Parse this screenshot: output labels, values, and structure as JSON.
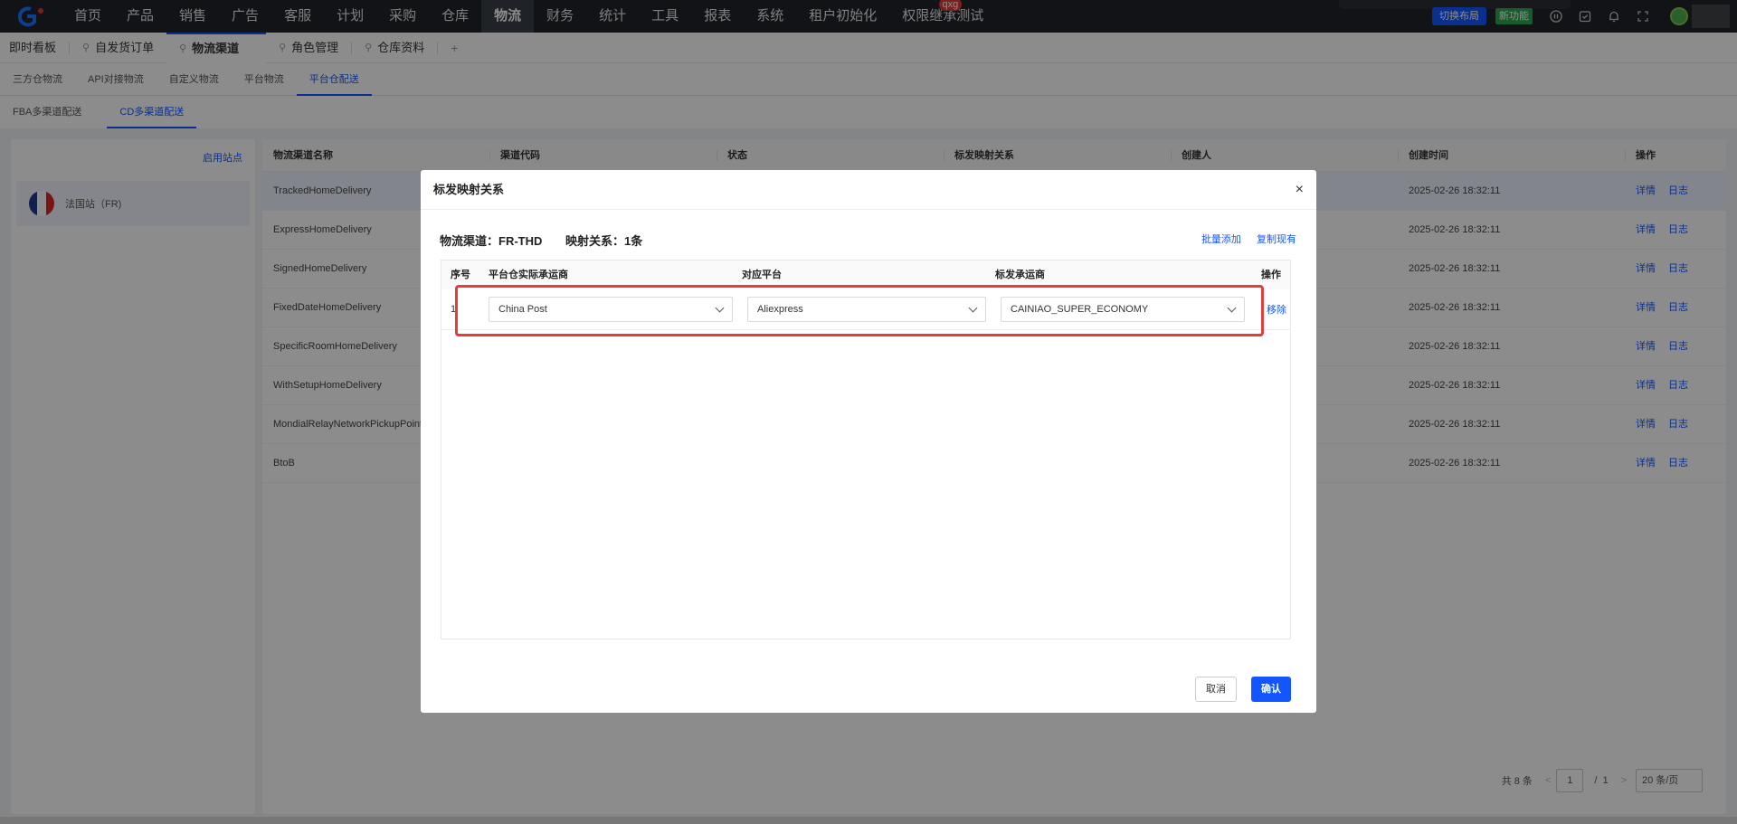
{
  "nav": {
    "items": [
      "首页",
      "产品",
      "销售",
      "广告",
      "客服",
      "计划",
      "采购",
      "仓库",
      "物流",
      "财务",
      "统计",
      "工具",
      "报表",
      "系统",
      "租户初始化",
      "权限继承测试"
    ],
    "active_index": 8,
    "badge": "qxg",
    "switch_layout": "切换布局",
    "new_feature": "新功能"
  },
  "tabs": {
    "first": "即时看板",
    "items": [
      "自发货订单",
      "物流渠道",
      "角色管理",
      "仓库资料"
    ],
    "add": "+"
  },
  "subnav": [
    "三方仓物流",
    "API对接物流",
    "自定义物流",
    "平台物流",
    "平台仓配送"
  ],
  "subnav2": [
    "FBA多渠道配送",
    "CD多渠道配送"
  ],
  "left": {
    "header": "启用站点",
    "site": "法国站（FR)"
  },
  "table": {
    "headers": [
      "物流渠道名称",
      "渠道代码",
      "状态",
      "标发映射关系",
      "创建人",
      "创建时间",
      "操作"
    ],
    "rows": [
      {
        "name": "TrackedHomeDelivery",
        "time": "2025-02-26 18:32:11"
      },
      {
        "name": "ExpressHomeDelivery",
        "time": "2025-02-26 18:32:11"
      },
      {
        "name": "SignedHomeDelivery",
        "time": "2025-02-26 18:32:11"
      },
      {
        "name": "FixedDateHomeDelivery",
        "time": "2025-02-26 18:32:11"
      },
      {
        "name": "SpecificRoomHomeDelivery",
        "time": "2025-02-26 18:32:11"
      },
      {
        "name": "WithSetupHomeDelivery",
        "time": "2025-02-26 18:32:11"
      },
      {
        "name": "MondialRelayNetworkPickupPoint",
        "time": "2025-02-26 18:32:11"
      },
      {
        "name": "BtoB",
        "time": "2025-02-26 18:32:11"
      }
    ],
    "detail": "详情",
    "log": "日志"
  },
  "pager": {
    "total": "共 8 条",
    "prev": "<",
    "current": "1",
    "sep": "/",
    "pages": "1",
    "next": ">",
    "size": "20 条/页"
  },
  "modal": {
    "title": "标发映射关系",
    "close": "×",
    "channel_label": "物流渠道：FR-THD",
    "mapping_label": "映射关系：1条",
    "batch_add": "批量添加",
    "copy_existing": "复制现有",
    "headers": [
      "序号",
      "平台仓实际承运商",
      "对应平台",
      "标发承运商",
      "操作"
    ],
    "row": {
      "index": "1",
      "carrier": "China Post",
      "platform": "Aliexpress",
      "std_carrier": "CAINIAO_SUPER_ECONOMY",
      "remove": "移除"
    },
    "cancel": "取消",
    "confirm": "确认"
  },
  "colors": {
    "accent": "#1356ff",
    "highlight": "#e53e3e",
    "nav_bg": "#1f2329"
  }
}
